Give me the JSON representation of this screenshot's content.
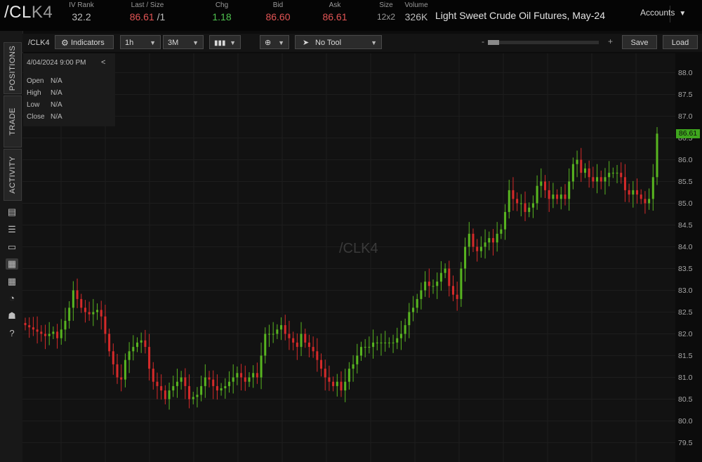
{
  "header": {
    "symbol_main": "/CL",
    "symbol_suffix": "K4",
    "stats": [
      {
        "label": "IV Rank",
        "value": "32.2",
        "color": "#bdbdbd"
      },
      {
        "label": "Last / Size",
        "value": "86.61",
        "extra": "/1",
        "color": "#e25555"
      },
      {
        "label": "Chg",
        "value": "1.18",
        "color": "#4fc24f"
      },
      {
        "label": "Bid",
        "value": "86.60",
        "color": "#e25555"
      },
      {
        "label": "Ask",
        "value": "86.61",
        "color": "#e25555"
      },
      {
        "label": "Size",
        "value": "12x2",
        "color": "#9a9a9a"
      },
      {
        "label": "Volume",
        "value": "326K",
        "color": "#bdbdbd"
      }
    ],
    "description": "Light Sweet Crude Oil Futures, May-24",
    "accounts_label": "Accounts",
    "chevron_icon": "chevron-down-icon"
  },
  "sidebar": {
    "tabs": [
      "POSITIONS",
      "TRADE",
      "ACTIVITY"
    ],
    "icons": [
      {
        "name": "document-icon",
        "glyph": "▤"
      },
      {
        "name": "list-icon",
        "glyph": "☰"
      },
      {
        "name": "tv-icon",
        "glyph": "▭"
      },
      {
        "name": "chart-icon",
        "glyph": "▦"
      },
      {
        "name": "grid-icon",
        "glyph": "▦"
      },
      {
        "name": "speedometer-icon",
        "glyph": "◔"
      },
      {
        "name": "community-icon",
        "glyph": "☗"
      },
      {
        "name": "help-icon",
        "glyph": "?"
      }
    ]
  },
  "toolbar": {
    "symbol": "/CLK4",
    "indicators_label": "Indicators",
    "interval": "1h",
    "range": "3M",
    "drawing_tool": "No Tool",
    "zoom_minus": "-",
    "zoom_plus": "+",
    "save_label": "Save",
    "load_label": "Load"
  },
  "infobox": {
    "datetime": "4/04/2024 9:00 PM",
    "collapse": "<",
    "rows": [
      {
        "label": "Open",
        "value": "N/A"
      },
      {
        "label": "High",
        "value": "N/A"
      },
      {
        "label": "Low",
        "value": "N/A"
      },
      {
        "label": "Close",
        "value": "N/A"
      }
    ]
  },
  "watermark": "/CLK4",
  "chart_data": {
    "type": "candlestick",
    "ylim": [
      79.25,
      88.25
    ],
    "yticks": [
      "88.0",
      "87.5",
      "87.0",
      "86.5",
      "86.0",
      "85.5",
      "85.0",
      "84.5",
      "84.0",
      "83.5",
      "83.0",
      "82.5",
      "82.0",
      "81.5",
      "81.0",
      "80.5",
      "80.0",
      "79.5"
    ],
    "last_value": "86.61",
    "up_color": "#58b520",
    "down_color": "#d62a2a",
    "closes": [
      82.2,
      82.15,
      82.1,
      82.05,
      82.0,
      81.95,
      82.0,
      82.05,
      81.9,
      82.1,
      82.3,
      82.6,
      83.0,
      82.8,
      82.6,
      82.5,
      82.45,
      82.5,
      82.55,
      82.4,
      82.0,
      81.6,
      81.3,
      81.0,
      80.95,
      81.4,
      81.6,
      81.7,
      81.8,
      81.85,
      81.7,
      81.2,
      80.9,
      80.8,
      80.7,
      80.5,
      80.7,
      80.8,
      80.9,
      81.0,
      80.8,
      80.5,
      80.55,
      80.6,
      80.8,
      81.0,
      80.95,
      80.8,
      80.7,
      80.75,
      80.8,
      80.9,
      81.0,
      81.1,
      81.0,
      80.9,
      81.0,
      81.1,
      81.0,
      81.5,
      82.0,
      82.0,
      82.0,
      82.1,
      82.2,
      82.0,
      81.9,
      81.8,
      81.7,
      82.0,
      81.8,
      81.7,
      81.6,
      81.4,
      81.2,
      81.0,
      80.9,
      80.8,
      80.9,
      80.7,
      80.9,
      81.2,
      81.3,
      81.5,
      81.7,
      81.7,
      81.7,
      81.8,
      81.8,
      81.8,
      81.8,
      81.8,
      81.8,
      81.9,
      82.0,
      82.2,
      82.5,
      82.6,
      82.8,
      83.0,
      83.2,
      83.1,
      83.1,
      83.2,
      83.4,
      83.5,
      83.1,
      82.9,
      82.8,
      83.5,
      84.0,
      84.3,
      84.0,
      83.9,
      84.0,
      84.1,
      84.2,
      84.1,
      84.3,
      84.4,
      84.8,
      85.3,
      85.1,
      85.0,
      85.0,
      84.8,
      84.9,
      85.0,
      85.4,
      85.5,
      85.3,
      85.1,
      85.2,
      85.1,
      85.2,
      85.1,
      85.5,
      85.9,
      86.0,
      85.7,
      85.8,
      85.6,
      85.5,
      85.6,
      85.5,
      85.6,
      85.7,
      85.7,
      85.7,
      85.6,
      85.3,
      85.2,
      85.3,
      85.2,
      85.1,
      85.0,
      85.1,
      85.6,
      86.6
    ]
  }
}
